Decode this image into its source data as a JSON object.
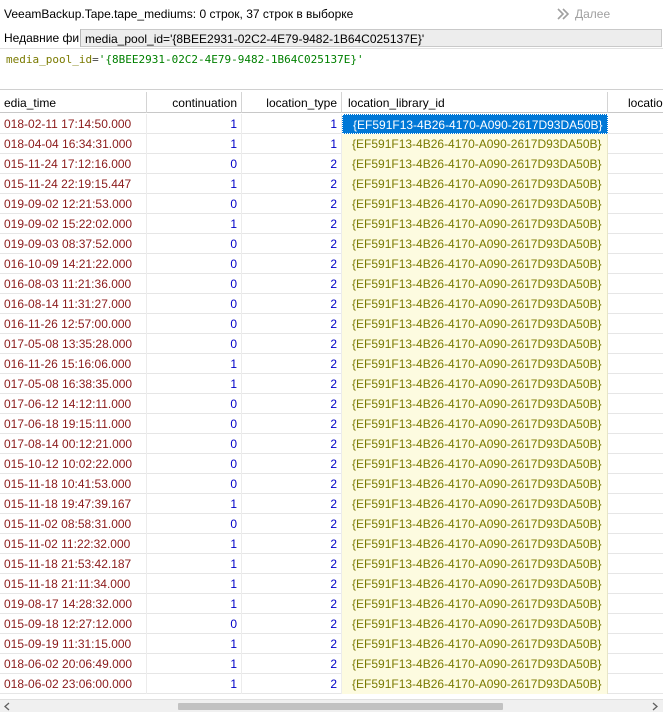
{
  "window": {
    "title": "VeeamBackup.Tape.tape_mediums: 0 строк, 37 строк в выборке",
    "next_label": "Далее",
    "next_icon": "double-chevron-right-icon"
  },
  "filter": {
    "recent_label": "Недавние фи",
    "dropdown_value": "media_pool_id='{8BEE2931-02C2-4E79-9482-1B64C025137E}'"
  },
  "query": {
    "key": "media_pool_id",
    "eq": "=",
    "value": "'{8BEE2931-02C2-4E79-9482-1B64C025137E}'"
  },
  "grid": {
    "columns": [
      "edia_time",
      "continuation",
      "location_type",
      "location_library_id",
      "locatio"
    ],
    "rows": [
      {
        "time": "018-02-11 17:14:50.000",
        "continuation": "1",
        "location_type": "1",
        "library_id": "{EF591F13-4B26-4170-A090-2617D93DA50B}"
      },
      {
        "time": "018-04-04 16:34:31.000",
        "continuation": "1",
        "location_type": "1",
        "library_id": "{EF591F13-4B26-4170-A090-2617D93DA50B}"
      },
      {
        "time": "015-11-24 17:12:16.000",
        "continuation": "0",
        "location_type": "2",
        "library_id": "{EF591F13-4B26-4170-A090-2617D93DA50B}"
      },
      {
        "time": "015-11-24 22:19:15.447",
        "continuation": "1",
        "location_type": "2",
        "library_id": "{EF591F13-4B26-4170-A090-2617D93DA50B}"
      },
      {
        "time": "019-09-02 12:21:53.000",
        "continuation": "0",
        "location_type": "2",
        "library_id": "{EF591F13-4B26-4170-A090-2617D93DA50B}"
      },
      {
        "time": "019-09-02 15:22:02.000",
        "continuation": "1",
        "location_type": "2",
        "library_id": "{EF591F13-4B26-4170-A090-2617D93DA50B}"
      },
      {
        "time": "019-09-03 08:37:52.000",
        "continuation": "0",
        "location_type": "2",
        "library_id": "{EF591F13-4B26-4170-A090-2617D93DA50B}"
      },
      {
        "time": "016-10-09 14:21:22.000",
        "continuation": "0",
        "location_type": "2",
        "library_id": "{EF591F13-4B26-4170-A090-2617D93DA50B}"
      },
      {
        "time": "016-08-03 11:21:36.000",
        "continuation": "0",
        "location_type": "2",
        "library_id": "{EF591F13-4B26-4170-A090-2617D93DA50B}"
      },
      {
        "time": "016-08-14 11:31:27.000",
        "continuation": "0",
        "location_type": "2",
        "library_id": "{EF591F13-4B26-4170-A090-2617D93DA50B}"
      },
      {
        "time": "016-11-26 12:57:00.000",
        "continuation": "0",
        "location_type": "2",
        "library_id": "{EF591F13-4B26-4170-A090-2617D93DA50B}"
      },
      {
        "time": "017-05-08 13:35:28.000",
        "continuation": "0",
        "location_type": "2",
        "library_id": "{EF591F13-4B26-4170-A090-2617D93DA50B}"
      },
      {
        "time": "016-11-26 15:16:06.000",
        "continuation": "1",
        "location_type": "2",
        "library_id": "{EF591F13-4B26-4170-A090-2617D93DA50B}"
      },
      {
        "time": "017-05-08 16:38:35.000",
        "continuation": "1",
        "location_type": "2",
        "library_id": "{EF591F13-4B26-4170-A090-2617D93DA50B}"
      },
      {
        "time": "017-06-12 14:12:11.000",
        "continuation": "0",
        "location_type": "2",
        "library_id": "{EF591F13-4B26-4170-A090-2617D93DA50B}"
      },
      {
        "time": "017-06-18 19:15:11.000",
        "continuation": "0",
        "location_type": "2",
        "library_id": "{EF591F13-4B26-4170-A090-2617D93DA50B}"
      },
      {
        "time": "017-08-14 00:12:21.000",
        "continuation": "0",
        "location_type": "2",
        "library_id": "{EF591F13-4B26-4170-A090-2617D93DA50B}"
      },
      {
        "time": "015-10-12 10:02:22.000",
        "continuation": "0",
        "location_type": "2",
        "library_id": "{EF591F13-4B26-4170-A090-2617D93DA50B}"
      },
      {
        "time": "015-11-18 10:41:53.000",
        "continuation": "0",
        "location_type": "2",
        "library_id": "{EF591F13-4B26-4170-A090-2617D93DA50B}"
      },
      {
        "time": "015-11-18 19:47:39.167",
        "continuation": "1",
        "location_type": "2",
        "library_id": "{EF591F13-4B26-4170-A090-2617D93DA50B}"
      },
      {
        "time": "015-11-02 08:58:31.000",
        "continuation": "0",
        "location_type": "2",
        "library_id": "{EF591F13-4B26-4170-A090-2617D93DA50B}"
      },
      {
        "time": "015-11-02 11:22:32.000",
        "continuation": "1",
        "location_type": "2",
        "library_id": "{EF591F13-4B26-4170-A090-2617D93DA50B}"
      },
      {
        "time": "015-11-18 21:53:42.187",
        "continuation": "1",
        "location_type": "2",
        "library_id": "{EF591F13-4B26-4170-A090-2617D93DA50B}"
      },
      {
        "time": "015-11-18 21:11:34.000",
        "continuation": "1",
        "location_type": "2",
        "library_id": "{EF591F13-4B26-4170-A090-2617D93DA50B}"
      },
      {
        "time": "019-08-17 14:28:32.000",
        "continuation": "1",
        "location_type": "2",
        "library_id": "{EF591F13-4B26-4170-A090-2617D93DA50B}"
      },
      {
        "time": "015-09-18 12:27:12.000",
        "continuation": "0",
        "location_type": "2",
        "library_id": "{EF591F13-4B26-4170-A090-2617D93DA50B}"
      },
      {
        "time": "015-09-19 11:31:15.000",
        "continuation": "1",
        "location_type": "2",
        "library_id": "{EF591F13-4B26-4170-A090-2617D93DA50B}"
      },
      {
        "time": "018-06-02 20:06:49.000",
        "continuation": "1",
        "location_type": "2",
        "library_id": "{EF591F13-4B26-4170-A090-2617D93DA50B}"
      },
      {
        "time": "018-06-02 23:06:00.000",
        "continuation": "1",
        "location_type": "2",
        "library_id": "{EF591F13-4B26-4170-A090-2617D93DA50B}"
      }
    ]
  },
  "colors": {
    "time_text": "#8b1a1a",
    "number_text": "#0000c8",
    "guid_text": "#7a7a00",
    "guid_bg": "#fdfbe0",
    "selection": "#0078d7"
  }
}
